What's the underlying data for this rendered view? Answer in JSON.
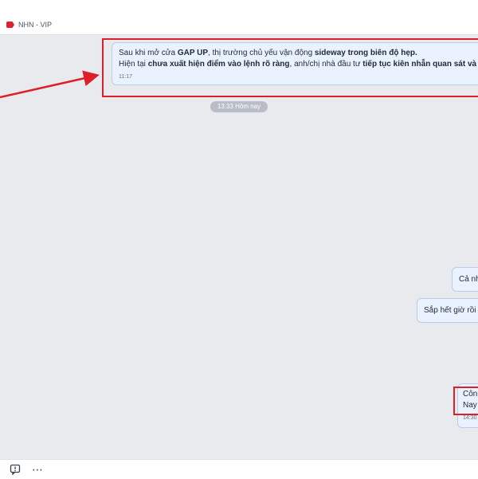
{
  "header": {
    "group_name": "NHN - VIP",
    "tag_color": "#e11d2e"
  },
  "messages": {
    "main": {
      "line1": {
        "t1": "Sau khi mở cửa ",
        "b1": "GAP UP",
        "t2": ", thị trường chủ yếu vận động ",
        "b2": "sideway trong biên độ hẹp."
      },
      "line2": {
        "t1": "Hiện tại ",
        "b1": "chưa xuất hiện điểm vào lệnh rõ ràng",
        "t2": ", anh/chị nhà đầu tư ",
        "b2": "tiếp tục kiên nhẫn quan sát và chờ tín hiệ"
      },
      "time": "11:17"
    },
    "date_separator": "13:33 Hôm nay",
    "right1": {
      "text": "Cả nh"
    },
    "right2": {
      "text": "Sắp hết giờ rồi c"
    },
    "right3": {
      "line1": "Côn",
      "line2": "Nay",
      "time": "14:30"
    }
  },
  "annotations": {
    "highlight_color": "#dc1f2b"
  },
  "toolbar": {
    "quote_icon": "quote-message-icon",
    "more_icon": "more-horizontal-icon",
    "more_glyph": "⋯"
  }
}
